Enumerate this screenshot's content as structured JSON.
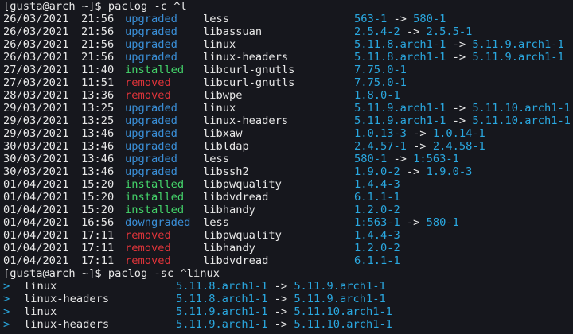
{
  "prompt1": "[gusta@arch ~]$ paclog -c ^l",
  "log": [
    {
      "date": "26/03/2021",
      "time": "21:56",
      "action": "upgraded",
      "pkg": "less",
      "old": "563-1",
      "arrow": "->",
      "new": "580-1"
    },
    {
      "date": "26/03/2021",
      "time": "21:56",
      "action": "upgraded",
      "pkg": "libassuan",
      "old": "2.5.4-2",
      "arrow": "->",
      "new": "2.5.5-1"
    },
    {
      "date": "26/03/2021",
      "time": "21:56",
      "action": "upgraded",
      "pkg": "linux",
      "old": "5.11.8.arch1-1",
      "arrow": "->",
      "new": "5.11.9.arch1-1"
    },
    {
      "date": "26/03/2021",
      "time": "21:56",
      "action": "upgraded",
      "pkg": "linux-headers",
      "old": "5.11.8.arch1-1",
      "arrow": "->",
      "new": "5.11.9.arch1-1"
    },
    {
      "date": "27/03/2021",
      "time": "11:40",
      "action": "installed",
      "pkg": "libcurl-gnutls",
      "old": "7.75.0-1",
      "arrow": "",
      "new": ""
    },
    {
      "date": "27/03/2021",
      "time": "11:51",
      "action": "removed",
      "pkg": "libcurl-gnutls",
      "old": "7.75.0-1",
      "arrow": "",
      "new": ""
    },
    {
      "date": "28/03/2021",
      "time": "13:36",
      "action": "removed",
      "pkg": "libwpe",
      "old": "1.8.0-1",
      "arrow": "",
      "new": ""
    },
    {
      "date": "29/03/2021",
      "time": "13:25",
      "action": "upgraded",
      "pkg": "linux",
      "old": "5.11.9.arch1-1",
      "arrow": "->",
      "new": "5.11.10.arch1-1"
    },
    {
      "date": "29/03/2021",
      "time": "13:25",
      "action": "upgraded",
      "pkg": "linux-headers",
      "old": "5.11.9.arch1-1",
      "arrow": "->",
      "new": "5.11.10.arch1-1"
    },
    {
      "date": "29/03/2021",
      "time": "13:46",
      "action": "upgraded",
      "pkg": "libxaw",
      "old": "1.0.13-3",
      "arrow": "->",
      "new": "1.0.14-1"
    },
    {
      "date": "30/03/2021",
      "time": "13:46",
      "action": "upgraded",
      "pkg": "libldap",
      "old": "2.4.57-1",
      "arrow": "->",
      "new": "2.4.58-1"
    },
    {
      "date": "30/03/2021",
      "time": "13:46",
      "action": "upgraded",
      "pkg": "less",
      "old": "580-1",
      "arrow": "->",
      "new": "1:563-1"
    },
    {
      "date": "30/03/2021",
      "time": "13:46",
      "action": "upgraded",
      "pkg": "libssh2",
      "old": "1.9.0-2",
      "arrow": "->",
      "new": "1.9.0-3"
    },
    {
      "date": "01/04/2021",
      "time": "15:20",
      "action": "installed",
      "pkg": "libpwquality",
      "old": "1.4.4-3",
      "arrow": "",
      "new": ""
    },
    {
      "date": "01/04/2021",
      "time": "15:20",
      "action": "installed",
      "pkg": "libdvdread",
      "old": "6.1.1-1",
      "arrow": "",
      "new": ""
    },
    {
      "date": "01/04/2021",
      "time": "15:20",
      "action": "installed",
      "pkg": "libhandy",
      "old": "1.2.0-2",
      "arrow": "",
      "new": ""
    },
    {
      "date": "01/04/2021",
      "time": "16:56",
      "action": "downgraded",
      "pkg": "less",
      "old": "1:563-1",
      "arrow": "->",
      "new": "580-1"
    },
    {
      "date": "01/04/2021",
      "time": "17:11",
      "action": "removed",
      "pkg": "libpwquality",
      "old": "1.4.4-3",
      "arrow": "",
      "new": ""
    },
    {
      "date": "01/04/2021",
      "time": "17:11",
      "action": "removed",
      "pkg": "libhandy",
      "old": "1.2.0-2",
      "arrow": "",
      "new": ""
    },
    {
      "date": "01/04/2021",
      "time": "17:11",
      "action": "removed",
      "pkg": "libdvdread",
      "old": "6.1.1-1",
      "arrow": "",
      "new": ""
    }
  ],
  "prompt2": "[gusta@arch ~]$ paclog -sc ^linux",
  "summary": [
    {
      "marker": ">",
      "pkg": "linux",
      "old": "5.11.8.arch1-1",
      "arrow": "->",
      "new": "5.11.9.arch1-1"
    },
    {
      "marker": ">",
      "pkg": "linux-headers",
      "old": "5.11.8.arch1-1",
      "arrow": "->",
      "new": "5.11.9.arch1-1"
    },
    {
      "marker": ">",
      "pkg": "linux",
      "old": "5.11.9.arch1-1",
      "arrow": "->",
      "new": "5.11.10.arch1-1"
    },
    {
      "marker": ">",
      "pkg": "linux-headers",
      "old": "5.11.9.arch1-1",
      "arrow": "->",
      "new": "5.11.10.arch1-1"
    }
  ],
  "colors": {
    "background": "#16171d",
    "text": "#e8e8e8",
    "upgraded": "#3a8fd8",
    "downgraded": "#3a8fd8",
    "installed": "#44d36a",
    "removed": "#e0343a",
    "version": "#2aa8e0"
  }
}
